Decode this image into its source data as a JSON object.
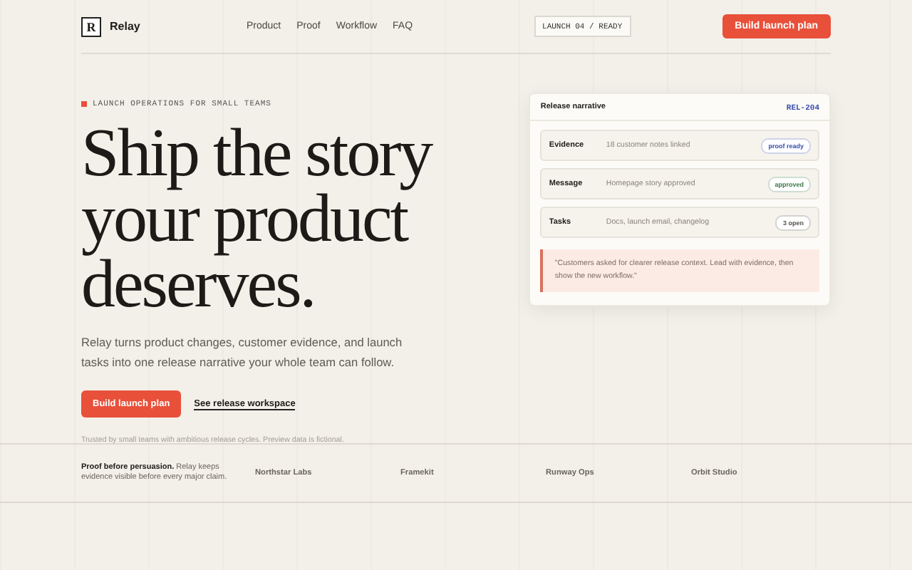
{
  "header": {
    "logo_letter": "R",
    "brand": "Relay",
    "nav": [
      "Product",
      "Proof",
      "Workflow",
      "FAQ"
    ],
    "status_chip": "LAUNCH 04 / READY",
    "cta": "Build launch plan"
  },
  "hero": {
    "eyebrow": "LAUNCH OPERATIONS FOR SMALL TEAMS",
    "headline": [
      "Ship the story",
      "your product",
      "deserves."
    ],
    "lede": "Relay turns product changes, customer evidence, and launch tasks into one release narrative your whole team can follow.",
    "primary_button": "Build launch plan",
    "secondary_link": "See release workspace",
    "note": "Trusted by small teams with ambitious release cycles. Preview data is fictional."
  },
  "card": {
    "title": "Release narrative",
    "id": "REL-204",
    "rows": [
      {
        "label": "Evidence",
        "detail": "18 customer notes linked",
        "badge": "proof ready",
        "color": "#3a4fb0"
      },
      {
        "label": "Message",
        "detail": "Homepage story approved",
        "badge": "approved",
        "color": "#3d7a4a"
      },
      {
        "label": "Tasks",
        "detail": "Docs, launch email, changelog",
        "badge": "3 open",
        "color": "#555049"
      }
    ],
    "quote": "\"Customers asked for clearer release context. Lead with evidence, then show the new workflow.\""
  },
  "proof_band": {
    "statement": "**Proof before persuasion.** Relay keeps evidence visible before every major claim.",
    "logos": [
      "Northstar Labs",
      "Framekit",
      "Runway Ops",
      "Orbit Studio"
    ]
  }
}
